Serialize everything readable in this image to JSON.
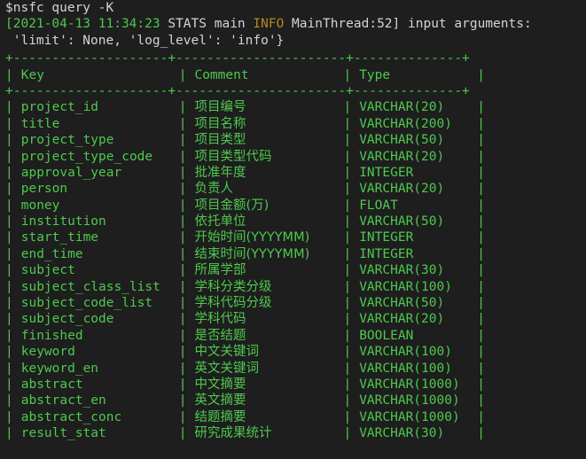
{
  "terminal": {
    "prompt_symbol": "$",
    "command": "nsfc query -K",
    "log": {
      "open_bracket": "[",
      "timestamp": "2021-04-13 11:34:23",
      "logger": "STATS",
      "thread_main": "main",
      "level": "INFO",
      "location": "MainThread:52]",
      "message": "input arguments:",
      "continuation": "'limit': None, 'log_level': 'info'}"
    },
    "table": {
      "border": "+--------------------+----------------------+--------------+",
      "headers": {
        "key": "Key",
        "comment": "Comment",
        "type": "Type"
      },
      "rows": [
        {
          "key": "project_id",
          "comment": "项目编号",
          "type": "VARCHAR(20)"
        },
        {
          "key": "title",
          "comment": "项目名称",
          "type": "VARCHAR(200)"
        },
        {
          "key": "project_type",
          "comment": "项目类型",
          "type": "VARCHAR(50)"
        },
        {
          "key": "project_type_code",
          "comment": "项目类型代码",
          "type": "VARCHAR(20)"
        },
        {
          "key": "approval_year",
          "comment": "批准年度",
          "type": "INTEGER"
        },
        {
          "key": "person",
          "comment": "负责人",
          "type": "VARCHAR(20)"
        },
        {
          "key": "money",
          "comment": "项目金额(万)",
          "type": "FLOAT"
        },
        {
          "key": "institution",
          "comment": "依托单位",
          "type": "VARCHAR(50)"
        },
        {
          "key": "start_time",
          "comment": "开始时间(YYYYMM)",
          "type": "INTEGER"
        },
        {
          "key": "end_time",
          "comment": "结束时间(YYYYMM)",
          "type": "INTEGER"
        },
        {
          "key": "subject",
          "comment": "所属学部",
          "type": "VARCHAR(30)"
        },
        {
          "key": "subject_class_list",
          "comment": "学科分类分级",
          "type": "VARCHAR(100)"
        },
        {
          "key": "subject_code_list",
          "comment": "学科代码分级",
          "type": "VARCHAR(50)"
        },
        {
          "key": "subject_code",
          "comment": "学科代码",
          "type": "VARCHAR(20)"
        },
        {
          "key": "finished",
          "comment": "是否结题",
          "type": "BOOLEAN"
        },
        {
          "key": "keyword",
          "comment": "中文关键词",
          "type": "VARCHAR(100)"
        },
        {
          "key": "keyword_en",
          "comment": "英文关键词",
          "type": "VARCHAR(100)"
        },
        {
          "key": "abstract",
          "comment": "中文摘要",
          "type": "VARCHAR(1000)"
        },
        {
          "key": "abstract_en",
          "comment": "英文摘要",
          "type": "VARCHAR(1000)"
        },
        {
          "key": "abstract_conc",
          "comment": "结题摘要",
          "type": "VARCHAR(1000)"
        },
        {
          "key": "result_stat",
          "comment": "研究成果统计",
          "type": "VARCHAR(30)"
        }
      ]
    }
  },
  "colors": {
    "background": "#1e1e1e",
    "text": "#d4d4d4",
    "green": "#4ec94e",
    "info": "#b5891d"
  }
}
